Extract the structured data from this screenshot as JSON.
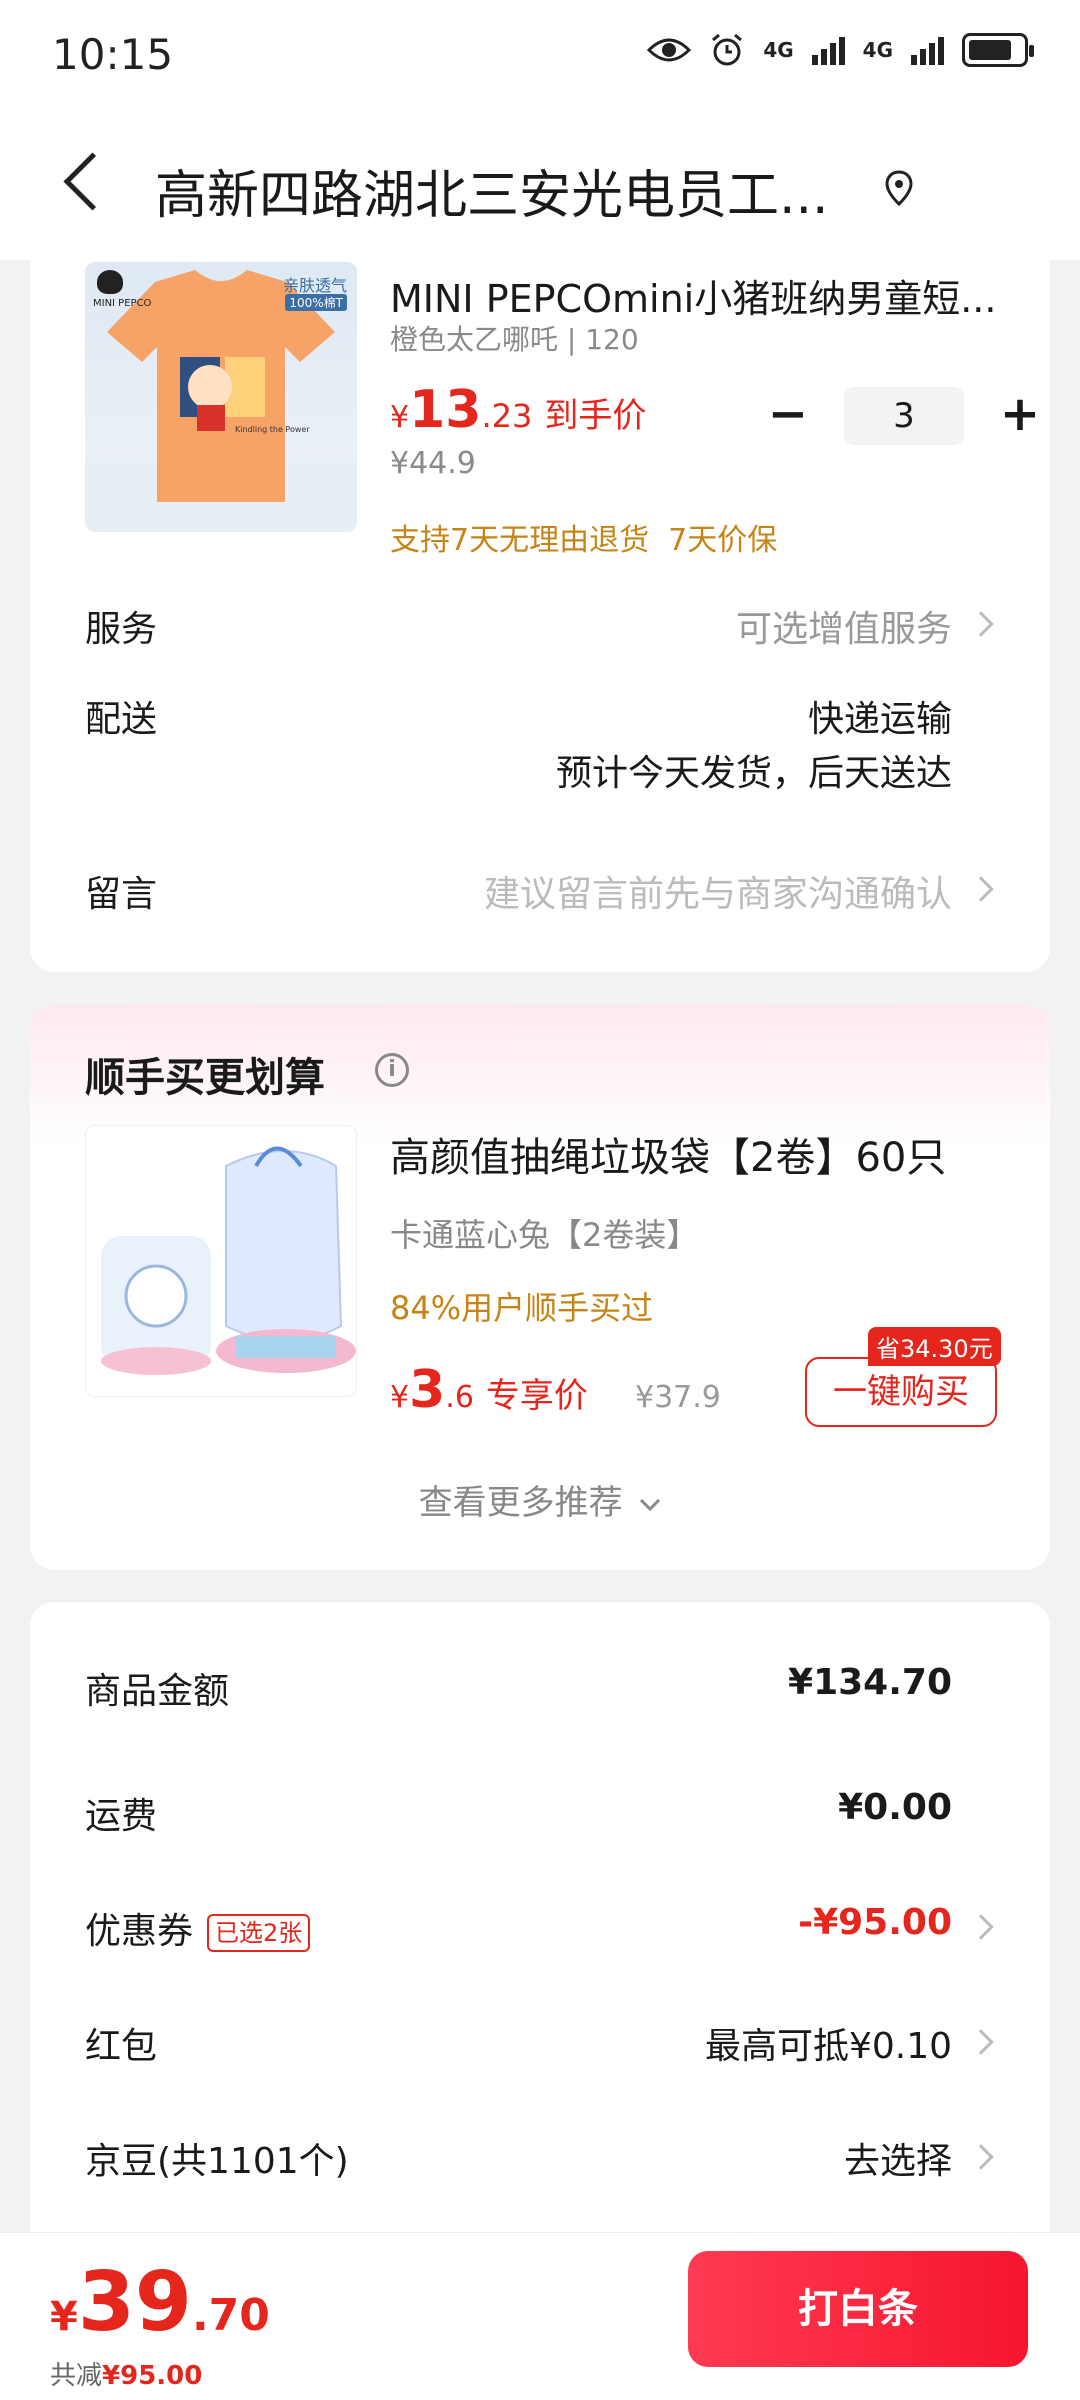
{
  "status_bar": {
    "time": "10:15",
    "net1": "4G",
    "net2": "4G"
  },
  "header": {
    "address": "高新四路湖北三安光电员工..."
  },
  "product": {
    "title": "MINI PEPCOmini小猪班纳男童短...",
    "sku": "橙色太乙哪吒 | 120",
    "price_currency": "¥",
    "price_int": "13",
    "price_dec": ".23",
    "price_tag": "到手价",
    "original_price": "¥44.9",
    "quantity": "3",
    "promise": "支持7天无理由退货  7天价保",
    "image_text": {
      "top_right": "亲肤透气",
      "badge": "100%棉T",
      "brand": "MINI PEPCO"
    }
  },
  "rows": {
    "service": {
      "label": "服务",
      "value": "可选增值服务"
    },
    "delivery": {
      "label": "配送",
      "value": "快递运输",
      "value2": "预计今天发货，后天送达"
    },
    "message": {
      "label": "留言",
      "value": "建议留言前先与商家沟通确认"
    }
  },
  "recommend": {
    "section_title": "顺手买更划算",
    "title": "高颜值抽绳垃圾袋【2卷】60只",
    "sku": "卡通蓝心兔【2卷装】",
    "bought": "84%用户顺手买过",
    "price_currency": "¥",
    "price_int": "3",
    "price_dec": ".6",
    "price_tag": "专享价",
    "original_price": "¥37.9",
    "save_badge": "省34.30元",
    "buy_label": "一键购买",
    "more_label": "查看更多推荐"
  },
  "summary": {
    "goods": {
      "label": "商品金额",
      "value": "¥134.70"
    },
    "freight": {
      "label": "运费",
      "value": "¥0.00"
    },
    "coupon": {
      "label": "优惠券",
      "badge": "已选2张",
      "value": "-¥95.00"
    },
    "redpacket": {
      "label": "红包",
      "value": "最高可抵¥0.10"
    },
    "jingdou": {
      "label": "京豆(共1101个)",
      "value": "去选择"
    }
  },
  "bottom": {
    "currency": "¥",
    "total_int": "39",
    "total_dec": ".70",
    "saved_label": "共减",
    "saved_amount": "¥95.00",
    "pay_label": "打白条"
  },
  "colors": {
    "accent": "#e4261c",
    "gold": "#c68316"
  }
}
